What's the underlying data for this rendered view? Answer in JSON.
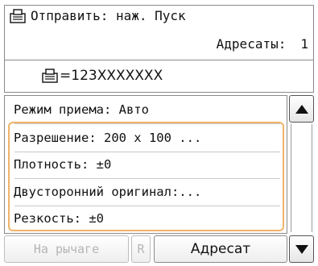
{
  "header": {
    "send_status": "Отправить: наж. Пуск",
    "recipients_label": "Адресаты:",
    "recipients_count": "1"
  },
  "destination": {
    "number": "123XXXXXXX"
  },
  "menu": {
    "items": [
      {
        "label": "Режим приема: Авто"
      },
      {
        "label": "Разрешение: 200 x 100 ..."
      },
      {
        "label": "Плотность: ±0"
      },
      {
        "label": "Двусторонний оригинал:..."
      },
      {
        "label": "Резкость: ±0"
      }
    ]
  },
  "bottom": {
    "on_hook_label": "На рычаге",
    "r_label": "R",
    "address_label": "Адресат"
  },
  "icons": {
    "fax": "fax-icon",
    "scroll_up": "triangle-up-icon",
    "scroll_down": "triangle-down-icon"
  },
  "colors": {
    "highlight": "#f0b46a"
  }
}
